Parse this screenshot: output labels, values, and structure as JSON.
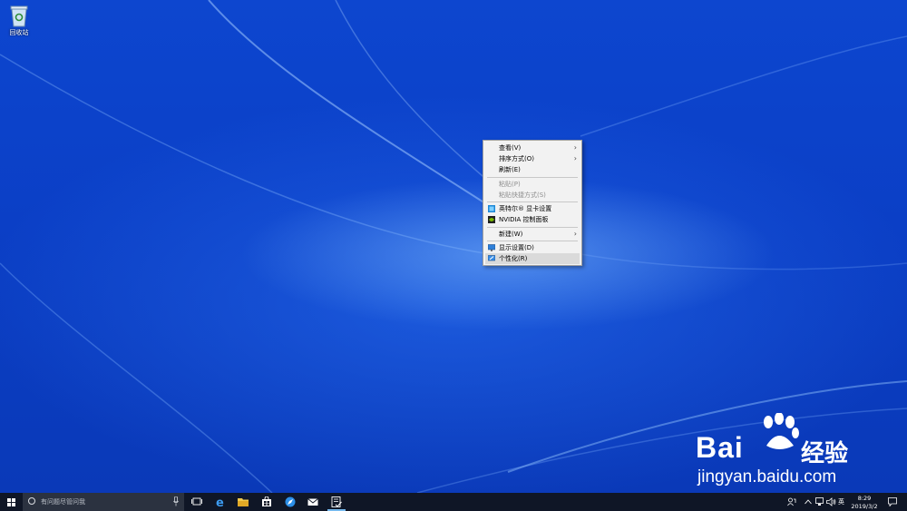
{
  "desktop": {
    "icons": [
      {
        "label": "回收站",
        "icon": "recycle-bin-icon"
      }
    ]
  },
  "context_menu": {
    "items": [
      {
        "label": "查看(V)",
        "submenu": true,
        "disabled": false
      },
      {
        "label": "排序方式(O)",
        "submenu": true,
        "disabled": false
      },
      {
        "label": "刷新(E)",
        "submenu": false,
        "disabled": false
      },
      {
        "label": "粘贴(P)",
        "submenu": false,
        "disabled": true
      },
      {
        "label": "粘贴快捷方式(S)",
        "submenu": false,
        "disabled": true
      },
      {
        "label": "英特尔® 显卡设置",
        "submenu": false,
        "disabled": false,
        "icon": "intel-graphics-icon"
      },
      {
        "label": "NVIDIA 控制面板",
        "submenu": false,
        "disabled": false,
        "icon": "nvidia-icon"
      },
      {
        "label": "新建(W)",
        "submenu": true,
        "disabled": false
      },
      {
        "label": "显示设置(D)",
        "submenu": false,
        "disabled": false,
        "icon": "display-settings-icon"
      },
      {
        "label": "个性化(R)",
        "submenu": false,
        "disabled": false,
        "icon": "personalize-icon",
        "highlighted": true
      }
    ],
    "submenu_arrow": "›"
  },
  "taskbar": {
    "search_placeholder": "有问题尽管问我",
    "tray": {
      "ime": "英"
    },
    "clock": {
      "time": "8:29",
      "date": "2019/3/2"
    }
  },
  "watermark": {
    "brand": "Bai",
    "cn": "经验",
    "url": "jingyan.baidu.com"
  },
  "colors": {
    "accent": "#76b9ed",
    "taskbar": "#0f1626",
    "menu_bg": "#f2f2f2"
  }
}
